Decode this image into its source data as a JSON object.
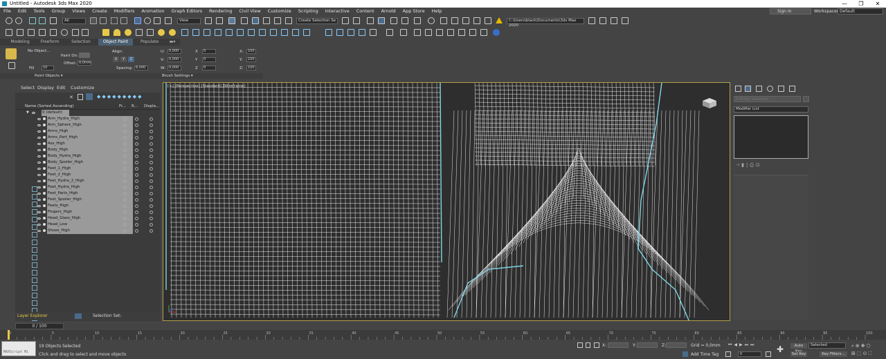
{
  "window": {
    "title": "Untitled - Autodesk 3ds Max 2020",
    "minimize": "—",
    "maximize": "❐",
    "close": "✕"
  },
  "menu": [
    "File",
    "Edit",
    "Tools",
    "Group",
    "Views",
    "Create",
    "Modifiers",
    "Animation",
    "Graph Editors",
    "Rendering",
    "Civil View",
    "Customize",
    "Scripting",
    "Interactive",
    "Content",
    "Arnold",
    "App Store",
    "Help"
  ],
  "account": {
    "signin": "Sign In",
    "workspaces_label": "Workspaces:",
    "workspace": "Default"
  },
  "toolbar": {
    "filter": "All",
    "view": "View",
    "selection_set": "Create Selection Se",
    "project_path": "C:\\Users\\black\\Documents\\3ds Max 2020"
  },
  "ribbon": {
    "tabs": [
      "Modeling",
      "Freeform",
      "Selection",
      "Object Paint",
      "Populate"
    ],
    "active_tab": "Object Paint",
    "no_object": "No Object...",
    "paint_on": "Paint On:",
    "fill": "Fill",
    "fill_value": "10",
    "offset_label": "Offset:",
    "offset_value": "0,0mm",
    "align_label": "Align:",
    "align_x": "X",
    "align_y": "Y",
    "align_z": "Z",
    "spacing_label": "Spacing:",
    "spacing_value": "6,000",
    "rot_u": "U:",
    "rot_v": "V:",
    "rot_w": "W:",
    "rot_u_val": "0,000",
    "rot_v_val": "0,000",
    "rot_w_val": "0,000",
    "x_label": "X",
    "y_label": "Y",
    "z_label": "Z",
    "x_val": "0",
    "y_val": "0",
    "z_val": "0",
    "sx_label": "X:",
    "sy_label": "Y:",
    "sz_label": "Z:",
    "sx_val": "100",
    "sy_val": "100",
    "sz_val": "100",
    "paint_objects": "Paint Objects ▾",
    "brush_settings": "Brush Settings ▾"
  },
  "scene_explorer": {
    "menu": [
      "Select",
      "Display",
      "Edit",
      "Customize"
    ],
    "col_name": "Name (Sorted Ascending)",
    "col_fr": "Fr...",
    "col_r": "R...",
    "col_disp": "Displa...",
    "root": "0 (default)",
    "objects": [
      "Arm_Hydra_High",
      "Arm_Sphere_High",
      "Arms_High",
      "Arms_Part_High",
      "Ass_High",
      "Body_High",
      "Body_Hydra_High",
      "Body_Spoiler_High",
      "Feet_1_High",
      "Feet_2_High",
      "Feet_Hydra_2_High",
      "Feet_Hydra_High",
      "Feet_Parts_High",
      "Feet_Spoiler_High",
      "Feets_High",
      "Fingers_High",
      "Head_Glass_High",
      "Head_Low",
      "Shoes_High"
    ],
    "layer_explorer": "Layer Explorer",
    "selection_set": "Selection Set:"
  },
  "viewport": {
    "label": "[+] [Perspective] [Standard] [Wireframe]"
  },
  "command_panel": {
    "name_placeholder": "0 Entity Selected",
    "modifier_list": "Modifier List"
  },
  "timeline": {
    "frame_display": "0 / 100",
    "ticks": [
      "0",
      "5",
      "10",
      "15",
      "20",
      "25",
      "30",
      "35",
      "40",
      "45",
      "50",
      "55",
      "60",
      "65",
      "70",
      "75",
      "80",
      "85",
      "90",
      "95",
      "100"
    ]
  },
  "status": {
    "maxscript": "MAXScript Mi",
    "objects_selected": "19 Objects Selected",
    "prompt": "Click and drag to select and move objects",
    "x_label": "X:",
    "y_label": "Y:",
    "z_label": "Z:",
    "grid": "Grid = 0,0mm",
    "add_time_tag": "Add Time Tag",
    "auto_key": "Auto Key",
    "set_key": "Set Key",
    "selected": "Selected",
    "key_filters": "Key Filters...",
    "frame": "0"
  },
  "colors": {
    "accent": "#4a6072",
    "viewport_border": "#b4a04a",
    "wire": "#ffffff",
    "wire_outline": "#7fd8e8"
  }
}
